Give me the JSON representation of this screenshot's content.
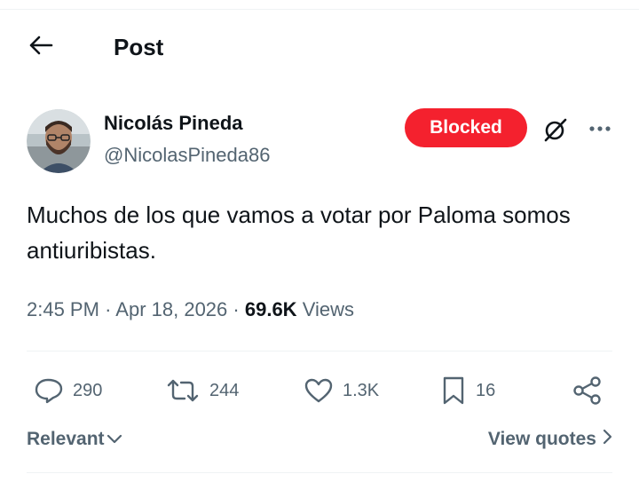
{
  "header": {
    "back_icon": "arrow-left-icon",
    "title": "Post"
  },
  "post": {
    "author": {
      "name": "Nicolás Pineda",
      "handle": "@NicolasPineda86"
    },
    "blocked_label": "Blocked",
    "text": "Muchos de los que vamos a votar por Paloma somos antiuribistas.",
    "time": "2:45 PM",
    "date": "Apr 18, 2026",
    "views_count": "69.6K",
    "views_label": "Views"
  },
  "actions": {
    "replies": "290",
    "reposts": "244",
    "likes": "1.3K",
    "bookmarks": "16"
  },
  "footer": {
    "sort_label": "Relevant",
    "view_quotes_label": "View quotes"
  },
  "colors": {
    "blocked_red": "#f4212e",
    "secondary_text": "#536471",
    "primary_text": "#0f1419"
  }
}
